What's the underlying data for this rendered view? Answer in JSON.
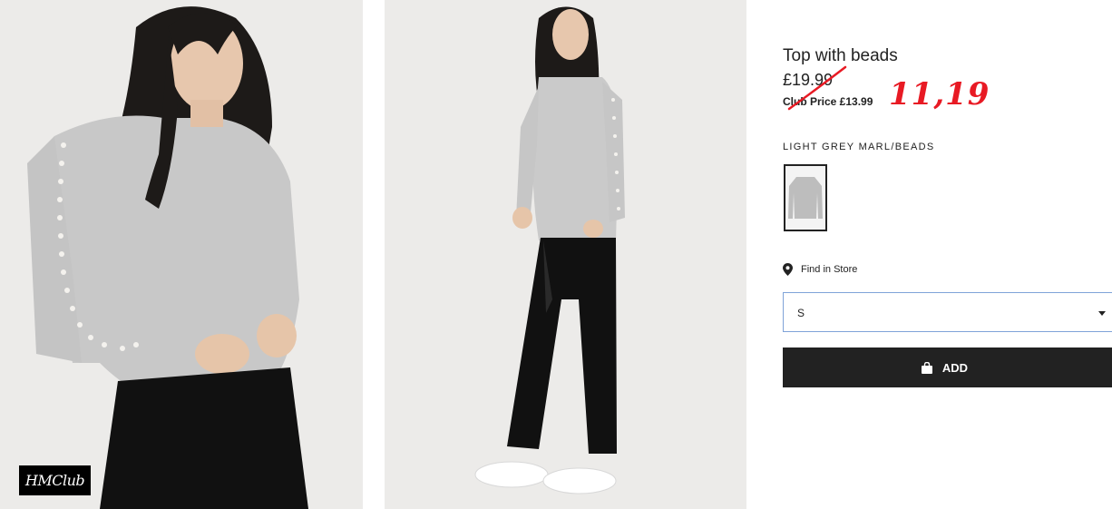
{
  "product": {
    "title": "Top with beads",
    "price": "£19.99",
    "club_price": "Club Price £13.99",
    "handwritten_price": "11,19",
    "color_name": "LIGHT GREY MARL/BEADS"
  },
  "badges": {
    "club_logo": "HMClub"
  },
  "store": {
    "find_label": "Find in Store"
  },
  "size_select": {
    "selected": "S"
  },
  "cart": {
    "add_label": "ADD"
  },
  "icons": {
    "location": "location-pin-icon",
    "bag": "shopping-bag-icon",
    "caret": "chevron-down-icon"
  },
  "colors": {
    "accent_annotation": "#e81a24",
    "button_bg": "#222222",
    "select_border": "#7fa3d8"
  }
}
